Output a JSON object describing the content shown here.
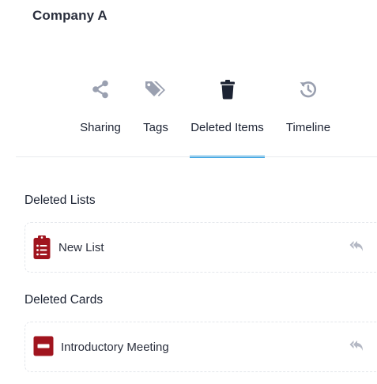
{
  "header": {
    "company_name": "Company A"
  },
  "tabs": [
    {
      "label": "Sharing",
      "icon": "share-icon",
      "active": false
    },
    {
      "label": "Tags",
      "icon": "tag-icon",
      "active": false
    },
    {
      "label": "Deleted Items",
      "icon": "trash-icon",
      "active": true
    },
    {
      "label": "Timeline",
      "icon": "history-icon",
      "active": false
    }
  ],
  "sections": {
    "deleted_lists": {
      "title": "Deleted Lists",
      "items": [
        {
          "label": "New List",
          "icon": "clipboard-list-icon",
          "action_icon": "restore-icon"
        }
      ]
    },
    "deleted_cards": {
      "title": "Deleted Cards",
      "items": [
        {
          "label": "Introductory Meeting",
          "icon": "minus-square-icon",
          "action_icon": "restore-icon"
        }
      ]
    }
  },
  "colors": {
    "accent": "#2b9fe3",
    "inactive_icon": "#9aa0b0",
    "active_icon": "#1c2333",
    "deleted_item_icon": "#a0141e",
    "restore_icon": "#b4b8c4"
  }
}
